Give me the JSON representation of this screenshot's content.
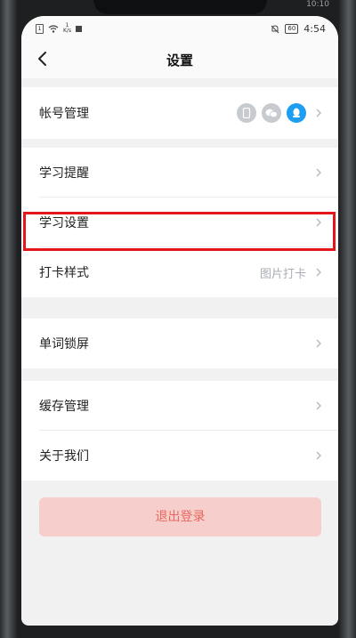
{
  "device": {
    "top_clock": "10:10"
  },
  "status_bar": {
    "sim_label": "1",
    "speed_value": "1",
    "speed_unit": "K/s",
    "battery": "60",
    "time": "4:54"
  },
  "header": {
    "title": "设置"
  },
  "settings": {
    "account": {
      "label": "帐号管理",
      "linked_icons": [
        "phone-icon",
        "wechat-icon",
        "qq-icon"
      ]
    },
    "study_reminder": {
      "label": "学习提醒"
    },
    "study_settings": {
      "label": "学习设置"
    },
    "checkin_style": {
      "label": "打卡样式",
      "value": "图片打卡"
    },
    "word_lockscreen": {
      "label": "单词锁屏"
    },
    "cache_management": {
      "label": "缓存管理"
    },
    "about_us": {
      "label": "关于我们"
    }
  },
  "logout": {
    "label": "退出登录"
  },
  "colors": {
    "accent_red": "#e4161b",
    "logout_bg": "#f6cfcd",
    "logout_text": "#e8675e",
    "qq_blue": "#1e9ef0"
  }
}
